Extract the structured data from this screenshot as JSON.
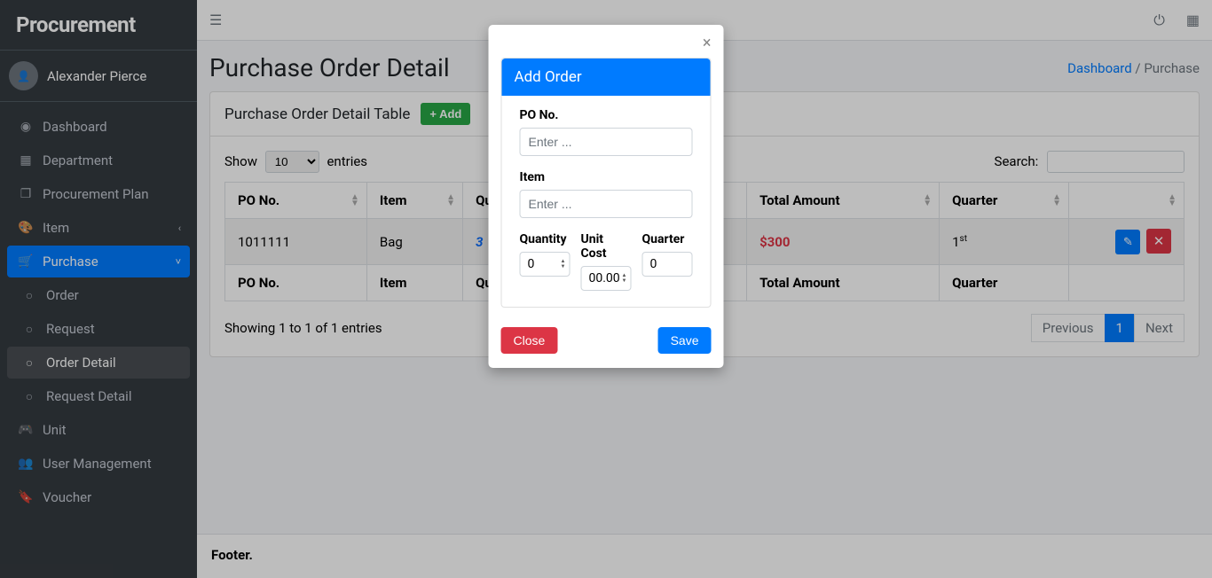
{
  "brand": "Procurement",
  "user_name": "Alexander Pierce",
  "sidebar": {
    "items": [
      {
        "label": "Dashboard",
        "icon": "◉"
      },
      {
        "label": "Department",
        "icon": "▦"
      },
      {
        "label": "Procurement Plan",
        "icon": "❐"
      },
      {
        "label": "Item",
        "icon": "🎨",
        "chevron": "‹"
      },
      {
        "label": "Purchase",
        "icon": "🛒",
        "chevron": "˅",
        "active": true
      },
      {
        "label": "Order",
        "icon": "○",
        "sub": true
      },
      {
        "label": "Request",
        "icon": "○",
        "sub": true
      },
      {
        "label": "Order Detail",
        "icon": "○",
        "sub": true,
        "subactive": true
      },
      {
        "label": "Request Detail",
        "icon": "○",
        "sub": true
      },
      {
        "label": "Unit",
        "icon": "🎮"
      },
      {
        "label": "User Management",
        "icon": "👥"
      },
      {
        "label": "Voucher",
        "icon": "🔖"
      }
    ]
  },
  "page": {
    "title": "Purchase Order Detail",
    "breadcrumb_dashboard": "Dashboard",
    "breadcrumb_current": "Purchase",
    "card_title": "Purchase Order Detail Table",
    "add_label": "+ Add"
  },
  "table": {
    "show_label": "Show",
    "entries_label": "entries",
    "page_size": "10",
    "search_label": "Search:",
    "headers": {
      "po": "PO No.",
      "item": "Item",
      "qty": "Qua...",
      "amount": "Total Amount",
      "quarter": "Quarter"
    },
    "footers": {
      "po": "PO No.",
      "item": "Item",
      "qty": "Qua...",
      "amount": "Total Amount",
      "quarter": "Quarter"
    },
    "rows": [
      {
        "po": "1011111",
        "item": "Bag",
        "qty": "3",
        "amount": "$300",
        "quarter_num": "1",
        "quarter_suffix": "st"
      }
    ],
    "info": "Showing 1 to 1 of 1 entries",
    "prev": "Previous",
    "next": "Next",
    "page_num": "1"
  },
  "footer": "Footer.",
  "modal": {
    "title": "Add Order",
    "po_label": "PO No.",
    "po_placeholder": "Enter ...",
    "item_label": "Item",
    "item_placeholder": "Enter ...",
    "qty_label": "Quantity",
    "qty_value": "0",
    "cost_label": "Unit Cost",
    "cost_value": "00.00",
    "quarter_label": "Quarter",
    "quarter_value": "0",
    "close": "Close",
    "save": "Save"
  }
}
